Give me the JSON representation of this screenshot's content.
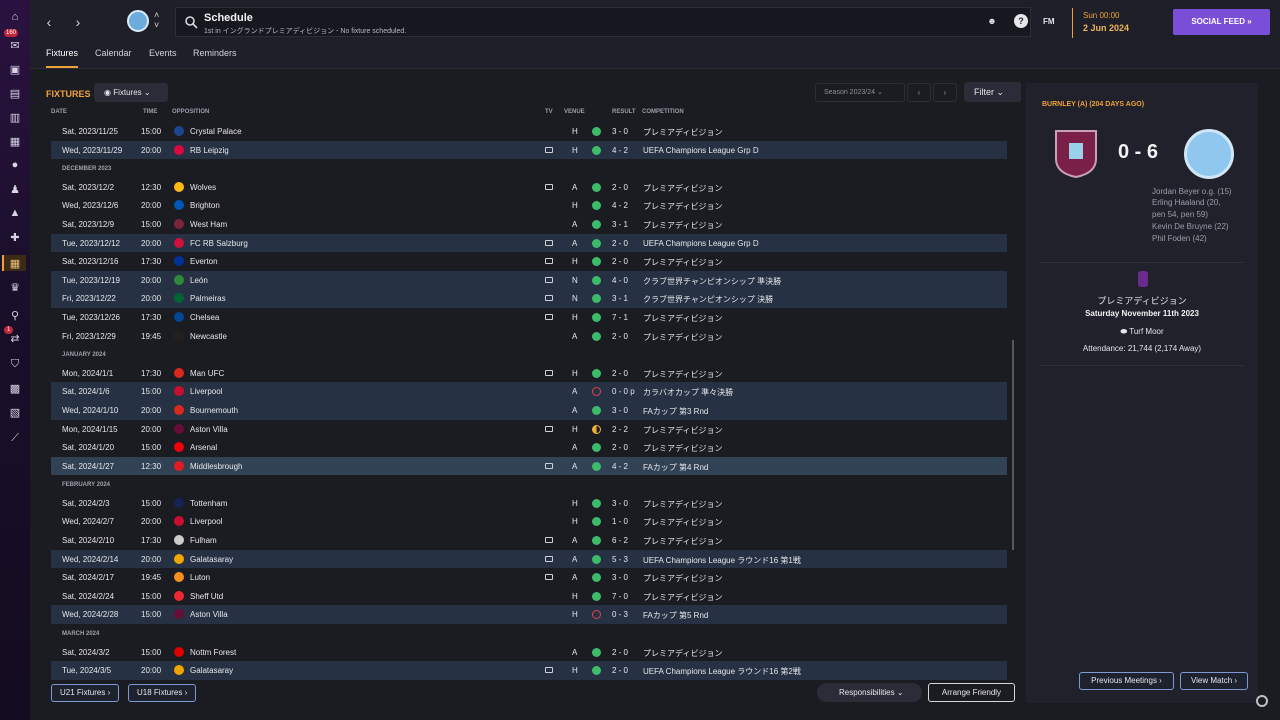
{
  "header": {
    "title": "Schedule",
    "subtitle": "1st in イングランドプレミアディビジョン - No fixture scheduled.",
    "fm_label": "FM",
    "date_line1": "Sun 00:00",
    "date_line2": "2 Jun 2024",
    "social_label": "SOCIAL FEED »"
  },
  "sidebar": {
    "badge1": "160",
    "badge2": "1"
  },
  "tabs": [
    "Fixtures",
    "Calendar",
    "Events",
    "Reminders"
  ],
  "main": {
    "section_label": "FIXTURES",
    "fixtures_dropdown": "Fixtures",
    "season": "Season 2023/24",
    "filter": "Filter",
    "columns": {
      "date": "DATE",
      "time": "TIME",
      "opposition": "OPPOSITION",
      "tv": "TV",
      "venue": "VENUE",
      "result": "RESULT",
      "competition": "COMPETITION"
    }
  },
  "fixtures": [
    {
      "date": "Sat, 2023/11/25",
      "time": "15:00",
      "opp": "Crystal Palace",
      "crest": "#1b458f",
      "tv": false,
      "venue": "H",
      "res": "win",
      "score": "3 - 0",
      "comp": "プレミアディビジョン",
      "hl": false
    },
    {
      "date": "Wed, 2023/11/29",
      "time": "20:00",
      "opp": "RB Leipzig",
      "crest": "#dd0741",
      "tv": true,
      "venue": "H",
      "res": "win",
      "score": "4 - 2",
      "comp": "UEFA Champions League Grp D",
      "hl": true
    },
    {
      "month": "DECEMBER 2023"
    },
    {
      "date": "Sat, 2023/12/2",
      "time": "12:30",
      "opp": "Wolves",
      "crest": "#fdb913",
      "tv": true,
      "venue": "A",
      "res": "win",
      "score": "2 - 0",
      "comp": "プレミアディビジョン",
      "hl": false
    },
    {
      "date": "Wed, 2023/12/6",
      "time": "20:00",
      "opp": "Brighton",
      "crest": "#0057b8",
      "tv": false,
      "venue": "H",
      "res": "win",
      "score": "4 - 2",
      "comp": "プレミアディビジョン",
      "hl": false
    },
    {
      "date": "Sat, 2023/12/9",
      "time": "15:00",
      "opp": "West Ham",
      "crest": "#7a263a",
      "tv": false,
      "venue": "A",
      "res": "win",
      "score": "3 - 1",
      "comp": "プレミアディビジョン",
      "hl": false
    },
    {
      "date": "Tue, 2023/12/12",
      "time": "20:00",
      "opp": "FC RB Salzburg",
      "crest": "#d0103a",
      "tv": true,
      "venue": "A",
      "res": "win",
      "score": "2 - 0",
      "comp": "UEFA Champions League Grp D",
      "hl": true
    },
    {
      "date": "Sat, 2023/12/16",
      "time": "17:30",
      "opp": "Everton",
      "crest": "#003399",
      "tv": true,
      "venue": "H",
      "res": "win",
      "score": "2 - 0",
      "comp": "プレミアディビジョン",
      "hl": false
    },
    {
      "date": "Tue, 2023/12/19",
      "time": "20:00",
      "opp": "León",
      "crest": "#2e8b3d",
      "tv": true,
      "venue": "N",
      "res": "win",
      "score": "4 - 0",
      "comp": "クラブ世界チャンピオンシップ 準決勝",
      "hl": true
    },
    {
      "date": "Fri, 2023/12/22",
      "time": "20:00",
      "opp": "Palmeiras",
      "crest": "#006437",
      "tv": true,
      "venue": "N",
      "res": "win",
      "score": "3 - 1",
      "comp": "クラブ世界チャンピオンシップ 決勝",
      "hl": true
    },
    {
      "date": "Tue, 2023/12/26",
      "time": "17:30",
      "opp": "Chelsea",
      "crest": "#034694",
      "tv": true,
      "venue": "H",
      "res": "win",
      "score": "7 - 1",
      "comp": "プレミアディビジョン",
      "hl": false
    },
    {
      "date": "Fri, 2023/12/29",
      "time": "19:45",
      "opp": "Newcastle",
      "crest": "#241f20",
      "tv": false,
      "venue": "A",
      "res": "win",
      "score": "2 - 0",
      "comp": "プレミアディビジョン",
      "hl": false
    },
    {
      "month": "JANUARY 2024"
    },
    {
      "date": "Mon, 2024/1/1",
      "time": "17:30",
      "opp": "Man UFC",
      "crest": "#da291c",
      "tv": true,
      "venue": "H",
      "res": "win",
      "score": "2 - 0",
      "comp": "プレミアディビジョン",
      "hl": false
    },
    {
      "date": "Sat, 2024/1/6",
      "time": "15:00",
      "opp": "Liverpool",
      "crest": "#c8102e",
      "tv": false,
      "venue": "A",
      "res": "loss",
      "score": "0 - 0 p",
      "comp": "カラバオカップ 準々決勝",
      "hl": true
    },
    {
      "date": "Wed, 2024/1/10",
      "time": "20:00",
      "opp": "Bournemouth",
      "crest": "#da291c",
      "tv": false,
      "venue": "A",
      "res": "win",
      "score": "3 - 0",
      "comp": "FAカップ 第3 Rnd",
      "hl": true
    },
    {
      "date": "Mon, 2024/1/15",
      "time": "20:00",
      "opp": "Aston Villa",
      "crest": "#670e36",
      "tv": true,
      "venue": "H",
      "res": "draw",
      "score": "2 - 2",
      "comp": "プレミアディビジョン",
      "hl": false
    },
    {
      "date": "Sat, 2024/1/20",
      "time": "15:00",
      "opp": "Arsenal",
      "crest": "#ef0107",
      "tv": false,
      "venue": "A",
      "res": "win",
      "score": "2 - 0",
      "comp": "プレミアディビジョン",
      "hl": false
    },
    {
      "date": "Sat, 2024/1/27",
      "time": "12:30",
      "opp": "Middlesbrough",
      "crest": "#e21a23",
      "tv": true,
      "venue": "A",
      "res": "win",
      "score": "4 - 2",
      "comp": "FAカップ 第4 Rnd",
      "hl": "sel"
    },
    {
      "month": "FEBRUARY 2024"
    },
    {
      "date": "Sat, 2024/2/3",
      "time": "15:00",
      "opp": "Tottenham",
      "crest": "#132257",
      "tv": false,
      "venue": "H",
      "res": "win",
      "score": "3 - 0",
      "comp": "プレミアディビジョン",
      "hl": false
    },
    {
      "date": "Wed, 2024/2/7",
      "time": "20:00",
      "opp": "Liverpool",
      "crest": "#c8102e",
      "tv": false,
      "venue": "H",
      "res": "win",
      "score": "1 - 0",
      "comp": "プレミアディビジョン",
      "hl": false
    },
    {
      "date": "Sat, 2024/2/10",
      "time": "17:30",
      "opp": "Fulham",
      "crest": "#cccccc",
      "tv": true,
      "venue": "A",
      "res": "win",
      "score": "6 - 2",
      "comp": "プレミアディビジョン",
      "hl": false
    },
    {
      "date": "Wed, 2024/2/14",
      "time": "20:00",
      "opp": "Galatasaray",
      "crest": "#f0a500",
      "tv": true,
      "venue": "A",
      "res": "win",
      "score": "5 - 3",
      "comp": "UEFA Champions League ラウンド16 第1戦",
      "hl": true
    },
    {
      "date": "Sat, 2024/2/17",
      "time": "19:45",
      "opp": "Luton",
      "crest": "#f78f1e",
      "tv": true,
      "venue": "A",
      "res": "win",
      "score": "3 - 0",
      "comp": "プレミアディビジョン",
      "hl": false
    },
    {
      "date": "Sat, 2024/2/24",
      "time": "15:00",
      "opp": "Sheff Utd",
      "crest": "#ee2737",
      "tv": false,
      "venue": "H",
      "res": "win",
      "score": "7 - 0",
      "comp": "プレミアディビジョン",
      "hl": false
    },
    {
      "date": "Wed, 2024/2/28",
      "time": "15:00",
      "opp": "Aston Villa",
      "crest": "#670e36",
      "tv": false,
      "venue": "H",
      "res": "loss",
      "score": "0 - 3",
      "comp": "FAカップ 第5 Rnd",
      "hl": true
    },
    {
      "month": "MARCH 2024"
    },
    {
      "date": "Sat, 2024/3/2",
      "time": "15:00",
      "opp": "Nottm Forest",
      "crest": "#dd0000",
      "tv": false,
      "venue": "A",
      "res": "win",
      "score": "2 - 0",
      "comp": "プレミアディビジョン",
      "hl": false
    },
    {
      "date": "Tue, 2024/3/5",
      "time": "20:00",
      "opp": "Galatasaray",
      "crest": "#f0a500",
      "tv": true,
      "venue": "H",
      "res": "win",
      "score": "2 - 0",
      "comp": "UEFA Champions League ラウンド16 第2戦",
      "hl": true
    }
  ],
  "bottom": {
    "u21": "U21 Fixtures ›",
    "u18": "U18 Fixtures ›",
    "responsibilities": "Responsibilities",
    "arrange": "Arrange Friendly"
  },
  "match_panel": {
    "title": "BURNLEY (A) (204 DAYS AGO)",
    "score": "0 - 6",
    "scorers": [
      "Jordan Beyer o.g. (15)",
      "Erling Haaland (20,",
      "pen 54, pen 59)",
      "Kevin De Bruyne (22)",
      "Phil Foden (42)"
    ],
    "competition": "プレミアディビジョン",
    "date": "Saturday November 11th 2023",
    "stadium": "Turf Moor",
    "attendance": "Attendance: 21,744 (2,174 Away)",
    "prev_meetings": "Previous Meetings ›",
    "view_match": "View Match ›"
  }
}
